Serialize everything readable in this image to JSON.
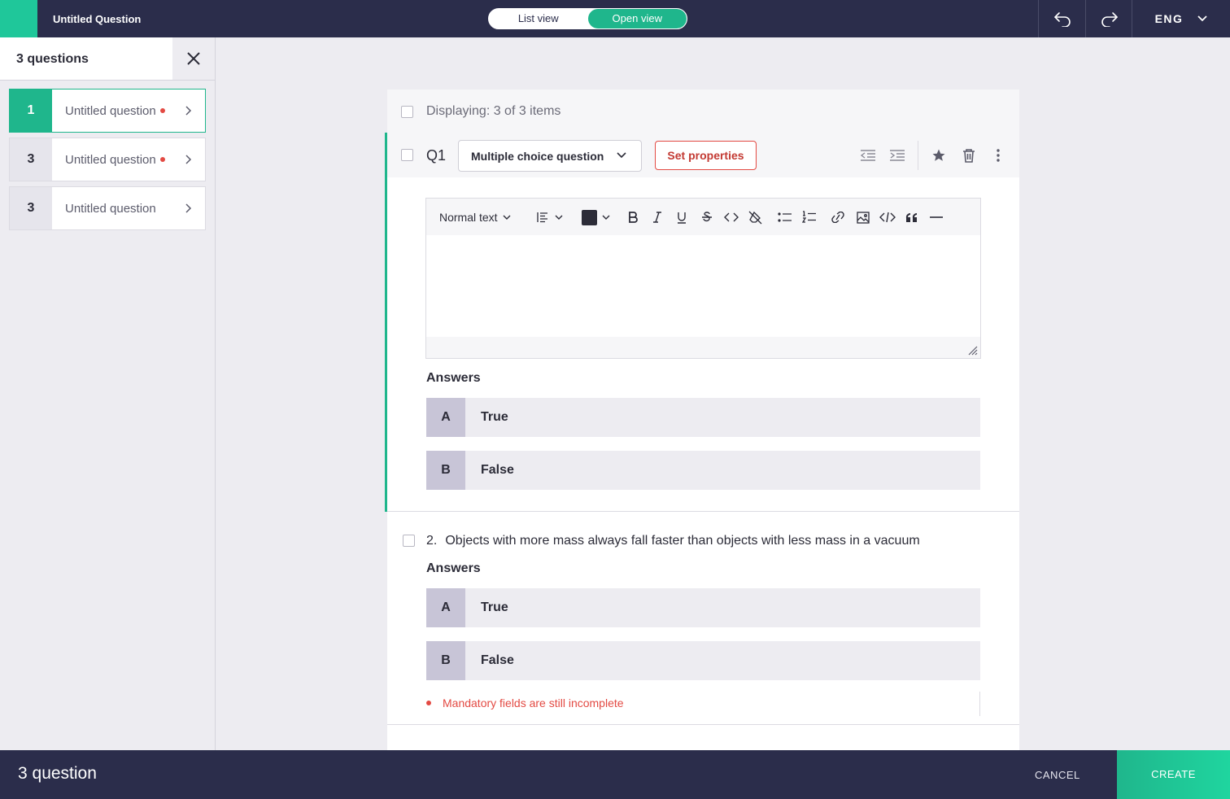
{
  "app": {
    "title": "Untitled Question",
    "brand_color": "#1fc79a"
  },
  "view_toggle": {
    "list": "List view",
    "open": "Open view",
    "selected": "Open view"
  },
  "language": "ENG",
  "sidebar": {
    "header": "3 questions",
    "items": [
      {
        "number": "1",
        "label": "Untitled question",
        "incomplete": true,
        "active": true
      },
      {
        "number": "3",
        "label": "Untitled question",
        "incomplete": true,
        "active": false
      },
      {
        "number": "3",
        "label": "Untitled question",
        "incomplete": false,
        "active": false
      }
    ]
  },
  "main": {
    "displaying": "Displaying: 3 of 3 items",
    "q1": {
      "label": "Q1",
      "type": "Multiple choice question",
      "set_properties": "Set properties",
      "editor": {
        "text_style": "Normal text",
        "text_color": "#2c2c38"
      },
      "answers_heading": "Answers",
      "answers": [
        {
          "letter": "A",
          "text": "True"
        },
        {
          "letter": "B",
          "text": "False"
        }
      ]
    },
    "q2": {
      "number": "2.",
      "text": "Objects with more mass always fall faster than objects with less mass in a vacuum",
      "answers_heading": "Answers",
      "answers": [
        {
          "letter": "A",
          "text": "True"
        },
        {
          "letter": "B",
          "text": "False"
        }
      ],
      "error": "Mandatory fields are still incomplete"
    }
  },
  "footer": {
    "count": "3 question",
    "cancel": "CANCEL",
    "create": "CREATE"
  }
}
